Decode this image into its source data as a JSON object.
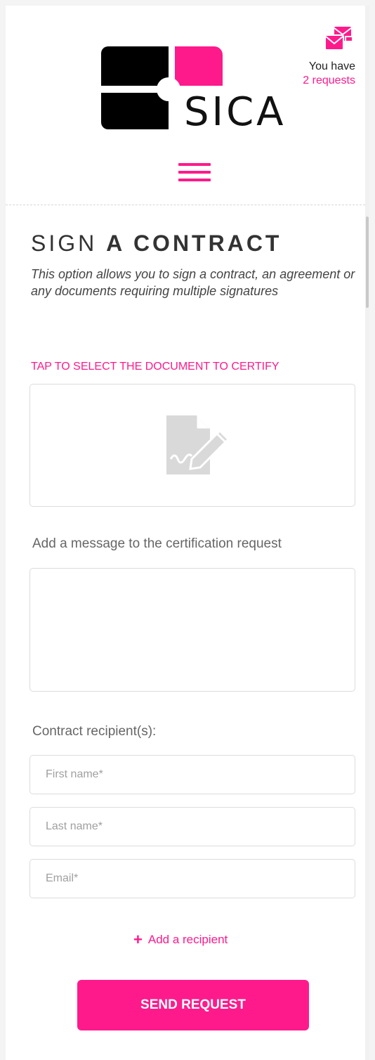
{
  "header": {
    "logo_text": "SICA",
    "requests_line1": "You have",
    "requests_line2": "2 requests"
  },
  "colors": {
    "accent": "#ff1a8c",
    "logo_black": "#000000",
    "border": "#dcdcdc"
  },
  "icons": {
    "requests": "envelope-stack-icon",
    "menu": "hamburger-menu-icon",
    "document": "document-signature-icon",
    "add": "plus-icon"
  },
  "main": {
    "title_light": "SIGN",
    "title_bold": "A CONTRACT",
    "description": "This option allows you to sign a contract, an agreement or any documents requiring multiple signatures",
    "tap_label": "TAP TO SELECT THE DOCUMENT TO CERTIFY",
    "message_label": "Add a message to the certification request",
    "message_value": "",
    "recipients_label": "Contract recipient(s):",
    "fields": {
      "first_name_placeholder": "First name*",
      "last_name_placeholder": "Last name*",
      "email_placeholder": "Email*"
    },
    "add_recipient_label": "Add a recipient",
    "submit_label": "SEND REQUEST"
  }
}
